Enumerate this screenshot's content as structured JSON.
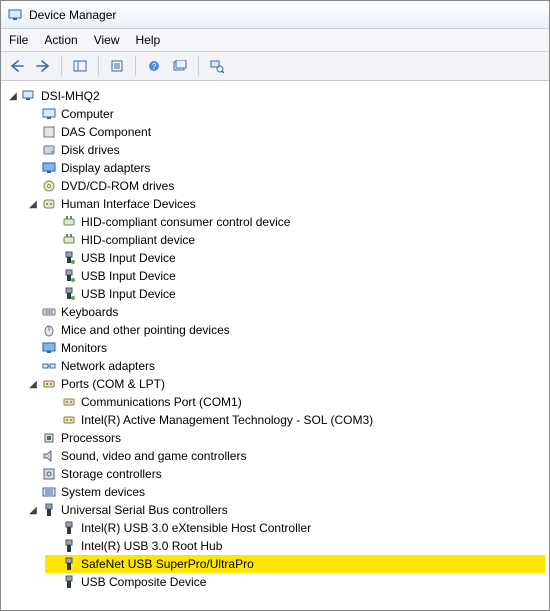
{
  "window": {
    "title": "Device Manager"
  },
  "menu": {
    "file": "File",
    "action": "Action",
    "view": "View",
    "help": "Help"
  },
  "tree": {
    "root": {
      "label": "DSI-MHQ2",
      "expanded": true,
      "children": [
        {
          "label": "Computer",
          "expanded": false,
          "icon": "computer"
        },
        {
          "label": "DAS Component",
          "expanded": false,
          "icon": "generic"
        },
        {
          "label": "Disk drives",
          "expanded": false,
          "icon": "disk"
        },
        {
          "label": "Display adapters",
          "expanded": false,
          "icon": "display"
        },
        {
          "label": "DVD/CD-ROM drives",
          "expanded": false,
          "icon": "cd"
        },
        {
          "label": "Human Interface Devices",
          "expanded": true,
          "icon": "hid",
          "children": [
            {
              "label": "HID-compliant consumer control device",
              "icon": "hid-leaf"
            },
            {
              "label": "HID-compliant device",
              "icon": "hid-leaf"
            },
            {
              "label": "USB Input Device",
              "icon": "usb-leaf"
            },
            {
              "label": "USB Input Device",
              "icon": "usb-leaf"
            },
            {
              "label": "USB Input Device",
              "icon": "usb-leaf"
            }
          ]
        },
        {
          "label": "Keyboards",
          "expanded": false,
          "icon": "keyboard"
        },
        {
          "label": "Mice and other pointing devices",
          "expanded": false,
          "icon": "mouse"
        },
        {
          "label": "Monitors",
          "expanded": false,
          "icon": "monitor"
        },
        {
          "label": "Network adapters",
          "expanded": false,
          "icon": "network"
        },
        {
          "label": "Ports (COM & LPT)",
          "expanded": true,
          "icon": "port",
          "children": [
            {
              "label": "Communications Port (COM1)",
              "icon": "port-leaf"
            },
            {
              "label": "Intel(R) Active Management Technology - SOL (COM3)",
              "icon": "port-leaf"
            }
          ]
        },
        {
          "label": "Processors",
          "expanded": false,
          "icon": "cpu"
        },
        {
          "label": "Sound, video and game controllers",
          "expanded": false,
          "icon": "sound"
        },
        {
          "label": "Storage controllers",
          "expanded": false,
          "icon": "storage"
        },
        {
          "label": "System devices",
          "expanded": false,
          "icon": "system"
        },
        {
          "label": "Universal Serial Bus controllers",
          "expanded": true,
          "icon": "usb",
          "children": [
            {
              "label": "Intel(R) USB 3.0 eXtensible Host Controller",
              "icon": "usb-plug"
            },
            {
              "label": "Intel(R) USB 3.0 Root Hub",
              "icon": "usb-plug"
            },
            {
              "label": "SafeNet USB SuperPro/UltraPro",
              "icon": "usb-plug",
              "highlight": true
            },
            {
              "label": "USB Composite Device",
              "icon": "usb-plug"
            }
          ]
        }
      ]
    }
  }
}
